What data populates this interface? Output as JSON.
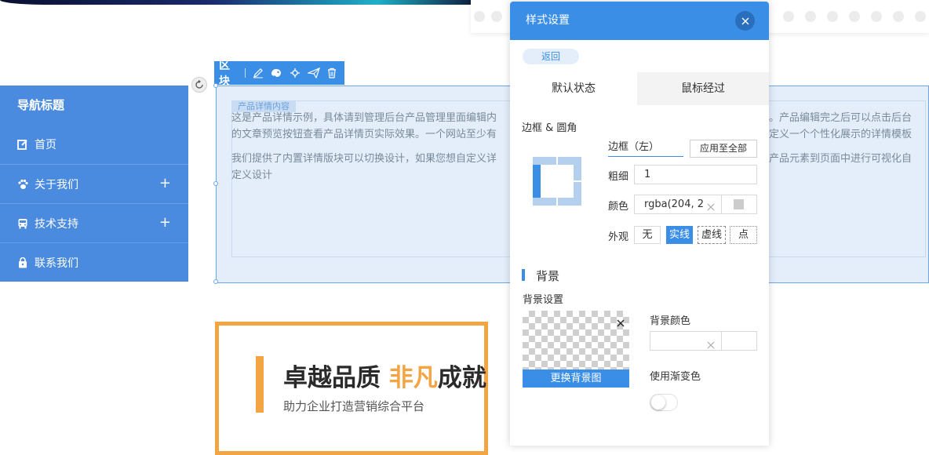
{
  "nav": {
    "title": "导航标题",
    "items": [
      {
        "label": "首页",
        "icon": "edit-icon",
        "expandable": false
      },
      {
        "label": "关于我们",
        "icon": "paw-icon",
        "expandable": true
      },
      {
        "label": "技术支持",
        "icon": "bus-icon",
        "expandable": true
      },
      {
        "label": "联系我们",
        "icon": "lock-bag-icon",
        "expandable": false
      }
    ],
    "expand_symbol": "+"
  },
  "block_toolbar": {
    "label": "区块",
    "tools": [
      "edit-icon",
      "palette-icon",
      "move-icon",
      "send-icon",
      "trash-icon"
    ]
  },
  "content": {
    "tag": "产品详情内容",
    "paragraph1_part1": "这是产品详情示例，具体请到管理后台产品管理里面编辑内",
    "paragraph1_part1_line2": "的文章预览按钮查看产品详情页实际效果。一个网站至少有",
    "paragraph1_part2": "。产品编辑完之后可以点击后台",
    "paragraph1_part2_line2": "定义一个个性化展示的详情模板",
    "paragraph2_part1": "我们提供了内置详情版块可以切换设计，如果您想自定义详",
    "paragraph2_part1_line2": "定义设计",
    "paragraph2_part2": "产品元素到页面中进行可视化自"
  },
  "promo": {
    "title_a": "卓越品质 ",
    "title_highlight": "非凡",
    "title_b": "成就",
    "subtitle": "助力企业打造营销综合平台"
  },
  "panel": {
    "title": "样式设置",
    "back_label": "返回",
    "tabs": [
      "默认状态",
      "鼠标经过"
    ],
    "border_section_label": "边框 & 圆角",
    "border_side_value": "边框（左）",
    "apply_all_label": "应用至全部",
    "thickness_label": "粗细",
    "thickness_value": "1",
    "color_label": "颜色",
    "color_value": "rgba(204, 2",
    "appearance_label": "外观",
    "appearance_options": [
      "无",
      "实线",
      "虚线",
      "点"
    ],
    "appearance_selected": "实线",
    "background_heading": "背景",
    "background_settings_label": "背景设置",
    "change_bg_label": "更换背景图",
    "bg_color_label": "背景颜色",
    "bg_color_value": "",
    "gradient_label": "使用渐变色",
    "gradient_enabled": false
  },
  "colors": {
    "accent": "#3a8ee6",
    "nav": "#4a8be0",
    "orange": "#f3a443",
    "block_bg": "#e3eefa"
  }
}
